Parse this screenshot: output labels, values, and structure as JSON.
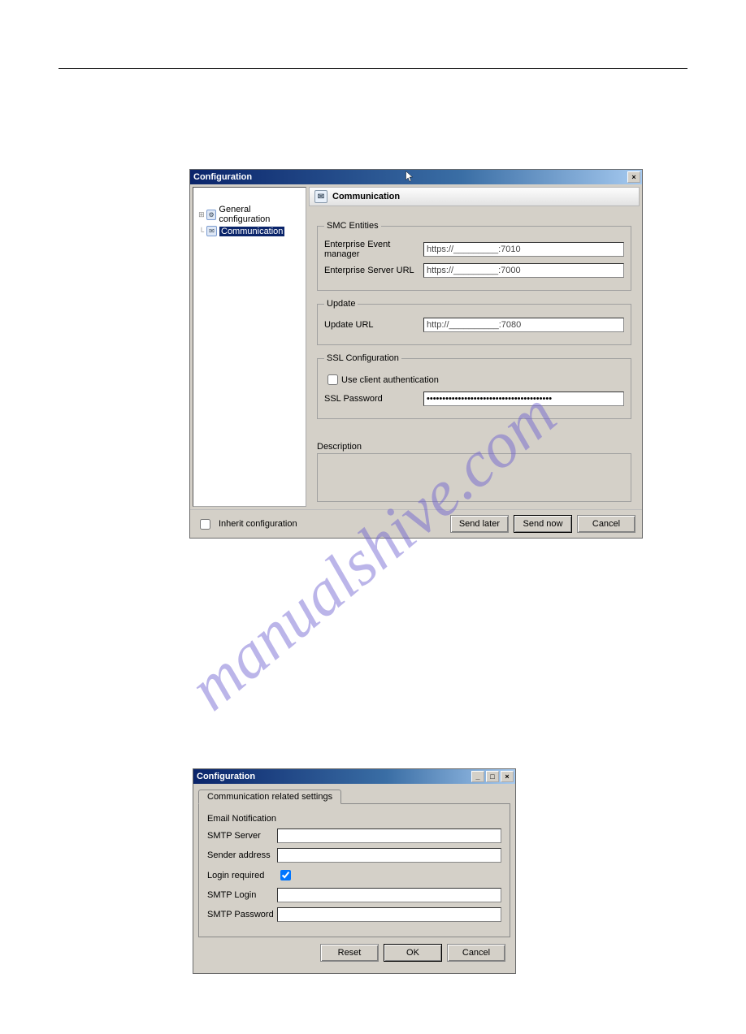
{
  "watermark": "manualshive.com",
  "win1": {
    "title": "Configuration",
    "close_label": "×",
    "tree": {
      "item_general": "General configuration",
      "item_comm": "Communication"
    },
    "header": "Communication",
    "smc_legend": "SMC Entities",
    "eem_label": "Enterprise Event manager",
    "eem_value": "https://_________:7010",
    "esu_label": "Enterprise Server URL",
    "esu_value": "https://_________:7000",
    "update_legend": "Update",
    "update_label": "Update URL",
    "update_value": "http://__________:7080",
    "ssl_legend": "SSL Configuration",
    "ssl_chk_label": "Use client authentication",
    "ssl_pw_label": "SSL Password",
    "ssl_pw_value": "••••••••••••••••••••••••••••••••••••••••",
    "desc_label": "Description",
    "inherit_label": "Inherit configuration",
    "btn_later": "Send later",
    "btn_now": "Send now",
    "btn_cancel": "Cancel"
  },
  "win2": {
    "title": "Configuration",
    "min_label": "_",
    "max_label": "□",
    "close_label": "×",
    "tab": "Communication related settings",
    "group_label": "Email Notification",
    "smtp_server_label": "SMTP Server",
    "smtp_server_value": "",
    "sender_label": "Sender address",
    "sender_value": "",
    "login_req_label": "Login required",
    "login_req_checked": true,
    "smtp_login_label": "SMTP Login",
    "smtp_login_value": "",
    "smtp_pw_label": "SMTP Password",
    "smtp_pw_value": "",
    "btn_reset": "Reset",
    "btn_ok": "OK",
    "btn_cancel": "Cancel"
  }
}
